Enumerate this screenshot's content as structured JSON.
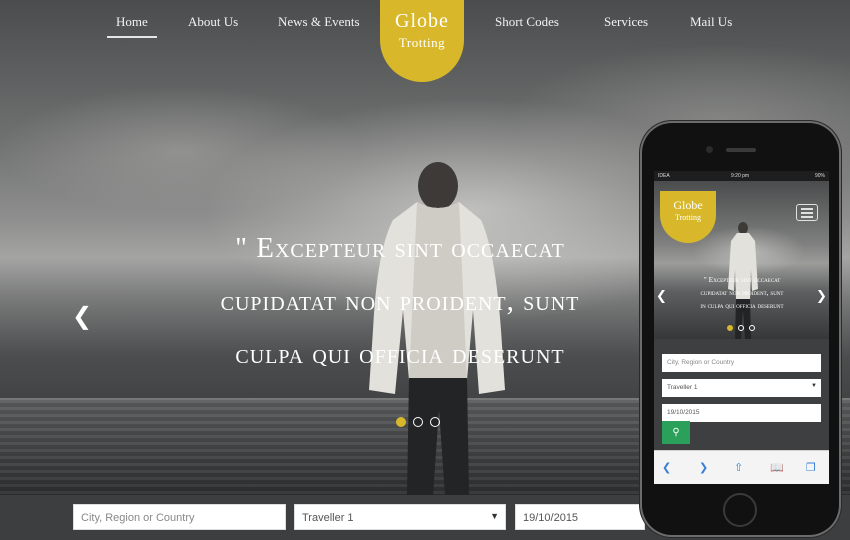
{
  "nav": {
    "items": [
      "Home",
      "About Us",
      "News & Events",
      "Short Codes",
      "Services",
      "Mail Us"
    ],
    "active": "Home"
  },
  "logo": {
    "line1": "Globe",
    "line2": "Trotting"
  },
  "hero": {
    "quote_lines": [
      "\" Excepteur sint occaecat",
      "cupidatat non proident, sunt",
      "culpa qui officia deserunt"
    ],
    "prev_icon": "chevron-left-icon",
    "slide_count": 3,
    "active_slide": 1
  },
  "search": {
    "location_placeholder": "City, Region or Country",
    "traveller_value": "Traveller 1",
    "date_value": "19/10/2015"
  },
  "phone": {
    "status": {
      "carrier": "IDEA",
      "time": "9:20 pm",
      "battery": "90%"
    },
    "logo": {
      "line1": "Globe",
      "line2": "Trotting"
    },
    "quote_lines": [
      "\" Excepteur sint occaecat",
      "cupidatat non proident, sunt",
      "in culpa qui officia deserunt"
    ],
    "location_placeholder": "City, Region or Country",
    "traveller_value": "Traveller 1",
    "date_value": "19/10/2015",
    "search_icon": "search-icon",
    "toolbar_icons": [
      "back-icon",
      "forward-icon",
      "share-icon",
      "bookmarks-icon",
      "tabs-icon"
    ]
  },
  "colors": {
    "accent": "#d8b82a",
    "search_button": "#2aa05a",
    "bar_background": "#3c3e40"
  }
}
